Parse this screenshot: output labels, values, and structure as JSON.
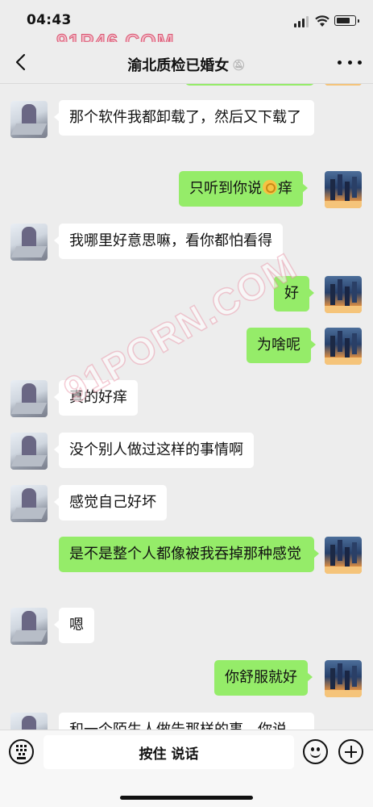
{
  "status_bar": {
    "time": "04:43"
  },
  "watermark": {
    "top": "91P46.COM",
    "diagonal": "91PORN.COM"
  },
  "header": {
    "title": "渝北质检已婚女"
  },
  "messages": [
    {
      "from": "her",
      "text": "那个软件我都卸载了，然后又下载了"
    },
    {
      "from": "me",
      "text_before": "只听到你说",
      "emoji": "ok-hand",
      "text_after": "痒"
    },
    {
      "from": "her",
      "text": "我哪里好意思嘛，看你都怕看得"
    },
    {
      "from": "me",
      "text": "好"
    },
    {
      "from": "me",
      "text": "为啥呢"
    },
    {
      "from": "her",
      "text": "真的好痒"
    },
    {
      "from": "her",
      "text": "没个别人做过这样的事情啊"
    },
    {
      "from": "her",
      "text": "感觉自己好坏"
    },
    {
      "from": "me",
      "text": "是不是整个人都像被我吞掉那种感觉"
    },
    {
      "from": "her",
      "text": "嗯"
    },
    {
      "from": "me",
      "text": "你舒服就好"
    },
    {
      "from": "her",
      "text": "和一个陌生人做告那样的事，你说"
    }
  ],
  "input_bar": {
    "hold_to_talk": "按住 说话"
  },
  "icons": {
    "back": "chevron-left-icon",
    "more": "more-dots-icon",
    "mute": "mute-icon",
    "keyboard": "keyboard-icon",
    "emoji": "emoji-icon",
    "plus": "plus-icon"
  },
  "colors": {
    "background": "#ededed",
    "bubble_self": "#95ec69",
    "bubble_other": "#ffffff"
  }
}
